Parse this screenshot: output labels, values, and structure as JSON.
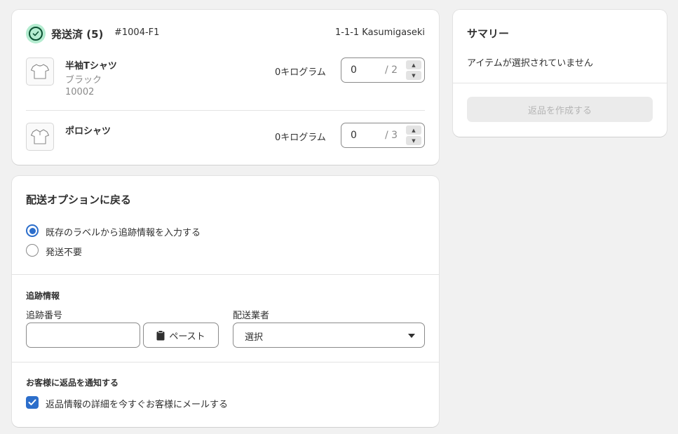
{
  "fulfilled": {
    "status_label": "発送済 (5)",
    "order_number": "#1004-F1",
    "address": "1-1-1 Kasumigaseki",
    "items": [
      {
        "name": "半袖Tシャツ",
        "variant": "ブラック",
        "sku": "10002",
        "weight": "0キログラム",
        "qty_value": "0",
        "qty_max": "/ 2"
      },
      {
        "name": "ポロシャツ",
        "weight": "0キログラム",
        "qty_value": "0",
        "qty_max": "/ 3"
      }
    ]
  },
  "return_shipping": {
    "title": "配送オプションに戻る",
    "options": [
      {
        "label": "既存のラベルから追跡情報を入力する",
        "selected": true
      },
      {
        "label": "発送不要",
        "selected": false
      }
    ],
    "tracking": {
      "heading": "追跡情報",
      "number_label": "追跡番号",
      "number_value": "",
      "paste_label": "ペースト",
      "carrier_label": "配送業者",
      "carrier_value": "選択"
    },
    "notify": {
      "heading": "お客様に返品を通知する",
      "checkbox_label": "返品情報の詳細を今すぐお客様にメールする",
      "checked": true
    }
  },
  "summary": {
    "title": "サマリー",
    "empty_text": "アイテムが選択されていません",
    "create_button": "返品を作成する"
  },
  "colors": {
    "accent": "#2c6ecb",
    "success_bg": "#b4ecd0",
    "success_fg": "#0c5132",
    "disabled_bg": "#ebebeb",
    "disabled_text": "#b5b5b5"
  }
}
